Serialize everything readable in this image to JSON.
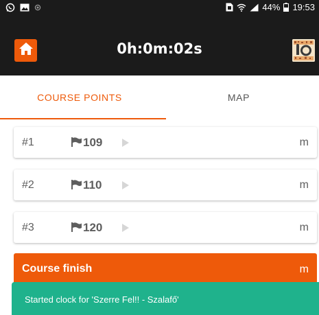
{
  "status_bar": {
    "battery": "44%",
    "time": "19:53",
    "icons": [
      "whatsapp-icon",
      "gallery-icon",
      "location-dot-icon",
      "sim-icon",
      "wifi-icon",
      "signal-icon",
      "battery-icon"
    ]
  },
  "app_bar": {
    "timer": "0h:0m:02s",
    "home_icon": "home-icon",
    "logo": "iorienteering-logo"
  },
  "tabs": [
    {
      "label": "COURSE POINTS",
      "active": true
    },
    {
      "label": "MAP",
      "active": false
    }
  ],
  "course_points": [
    {
      "number": "#1",
      "code": "109",
      "unit": "m"
    },
    {
      "number": "#2",
      "code": "110",
      "unit": "m"
    },
    {
      "number": "#3",
      "code": "120",
      "unit": "m"
    }
  ],
  "finish": {
    "label": "Course finish",
    "unit": "m"
  },
  "toast": {
    "message": "Started clock for 'Szerre Fel!! - Szalafő'"
  },
  "colors": {
    "accent": "#ee5a0a",
    "toast": "#1fb28c",
    "bar": "#1b1b1b"
  }
}
